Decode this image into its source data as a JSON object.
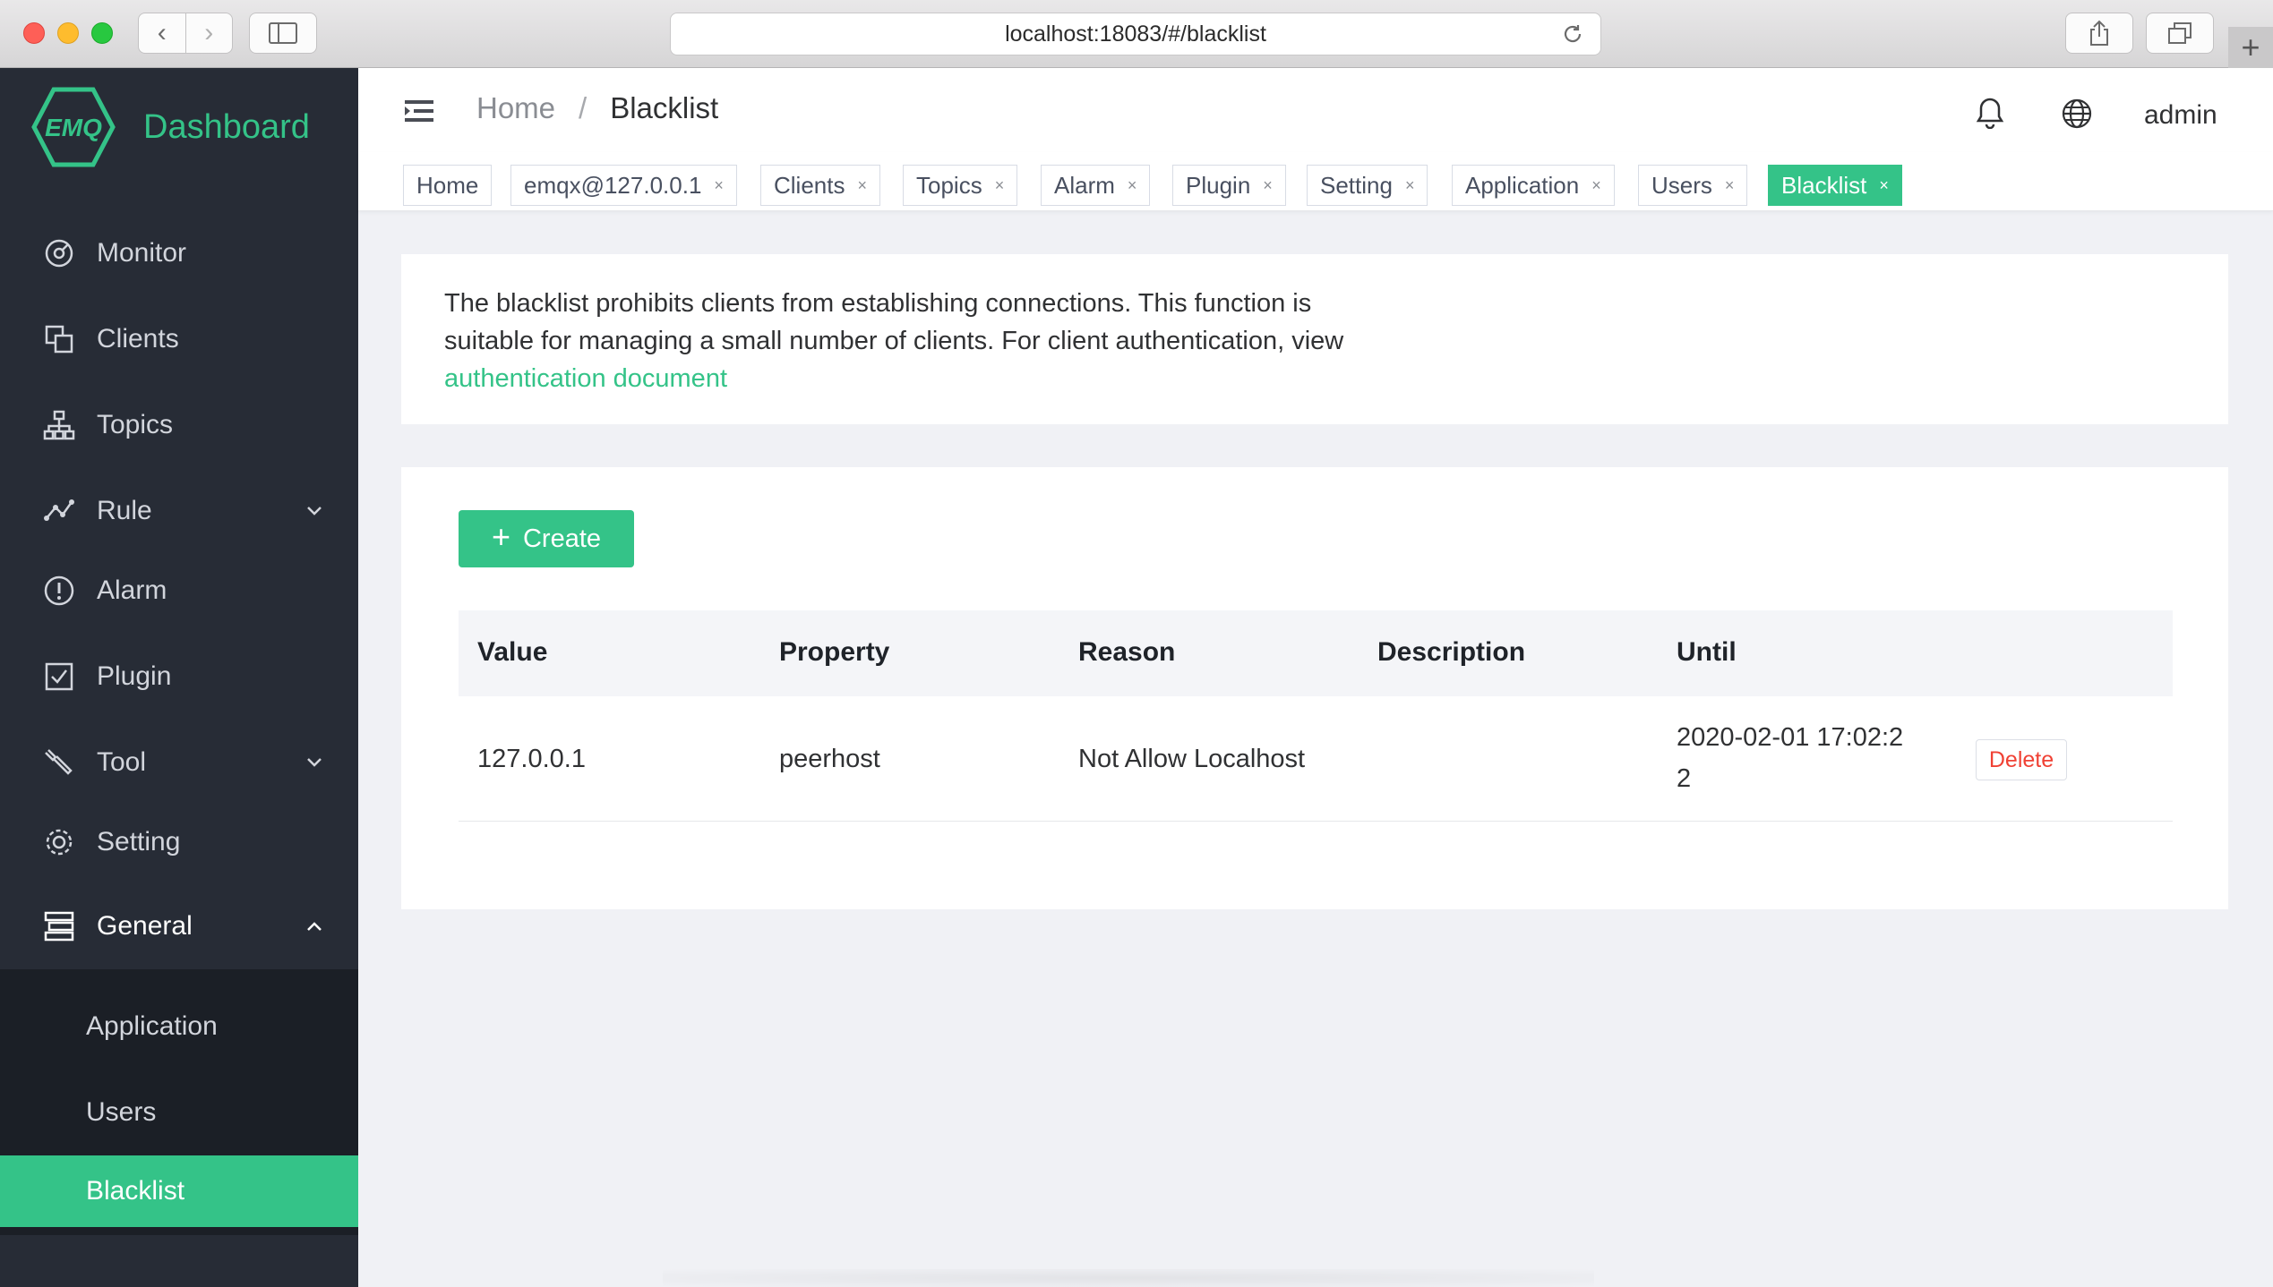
{
  "browser": {
    "url": "localhost:18083/#/blacklist",
    "back_icon": "‹",
    "forward_icon": "›",
    "newtab_icon": "+"
  },
  "sidebar": {
    "logo_text": "Dashboard",
    "logo_badge": "EMQ",
    "items": [
      {
        "label": "Monitor",
        "icon": "monitor-icon"
      },
      {
        "label": "Clients",
        "icon": "clients-icon"
      },
      {
        "label": "Topics",
        "icon": "topics-icon"
      },
      {
        "label": "Rule",
        "icon": "rule-icon"
      },
      {
        "label": "Alarm",
        "icon": "alarm-icon"
      },
      {
        "label": "Plugin",
        "icon": "plugin-icon"
      },
      {
        "label": "Tool",
        "icon": "tool-icon"
      },
      {
        "label": "Setting",
        "icon": "setting-icon"
      },
      {
        "label": "General",
        "icon": "general-icon"
      }
    ],
    "sub_items": [
      "Application",
      "Users",
      "Blacklist"
    ],
    "accent": "#34c388",
    "bg": "#272c36"
  },
  "header": {
    "breadcrumb_home": "Home",
    "breadcrumb_sep": "/",
    "breadcrumb_current": "Blacklist",
    "user": "admin"
  },
  "tags": [
    {
      "label": "Home"
    },
    {
      "label": "emqx@127.0.0.1"
    },
    {
      "label": "Clients"
    },
    {
      "label": "Topics"
    },
    {
      "label": "Alarm"
    },
    {
      "label": "Plugin"
    },
    {
      "label": "Setting"
    },
    {
      "label": "Application"
    },
    {
      "label": "Users"
    },
    {
      "label": "Blacklist"
    }
  ],
  "tag_close": "×",
  "description": {
    "text": "The blacklist prohibits clients from establishing connections. This function is suitable for managing a small number of clients. For client authentication, view",
    "link": "authentication document"
  },
  "create_button": {
    "label": "Create",
    "icon": "+"
  },
  "table": {
    "columns": [
      "Value",
      "Property",
      "Reason",
      "Description",
      "Until"
    ],
    "rows": [
      {
        "value": "127.0.0.1",
        "property": "peerhost",
        "reason": "Not Allow Localhost",
        "description": "",
        "until_line1": "2020-02-01 17:02:2",
        "until_line2": "2",
        "action": "Delete"
      }
    ]
  }
}
